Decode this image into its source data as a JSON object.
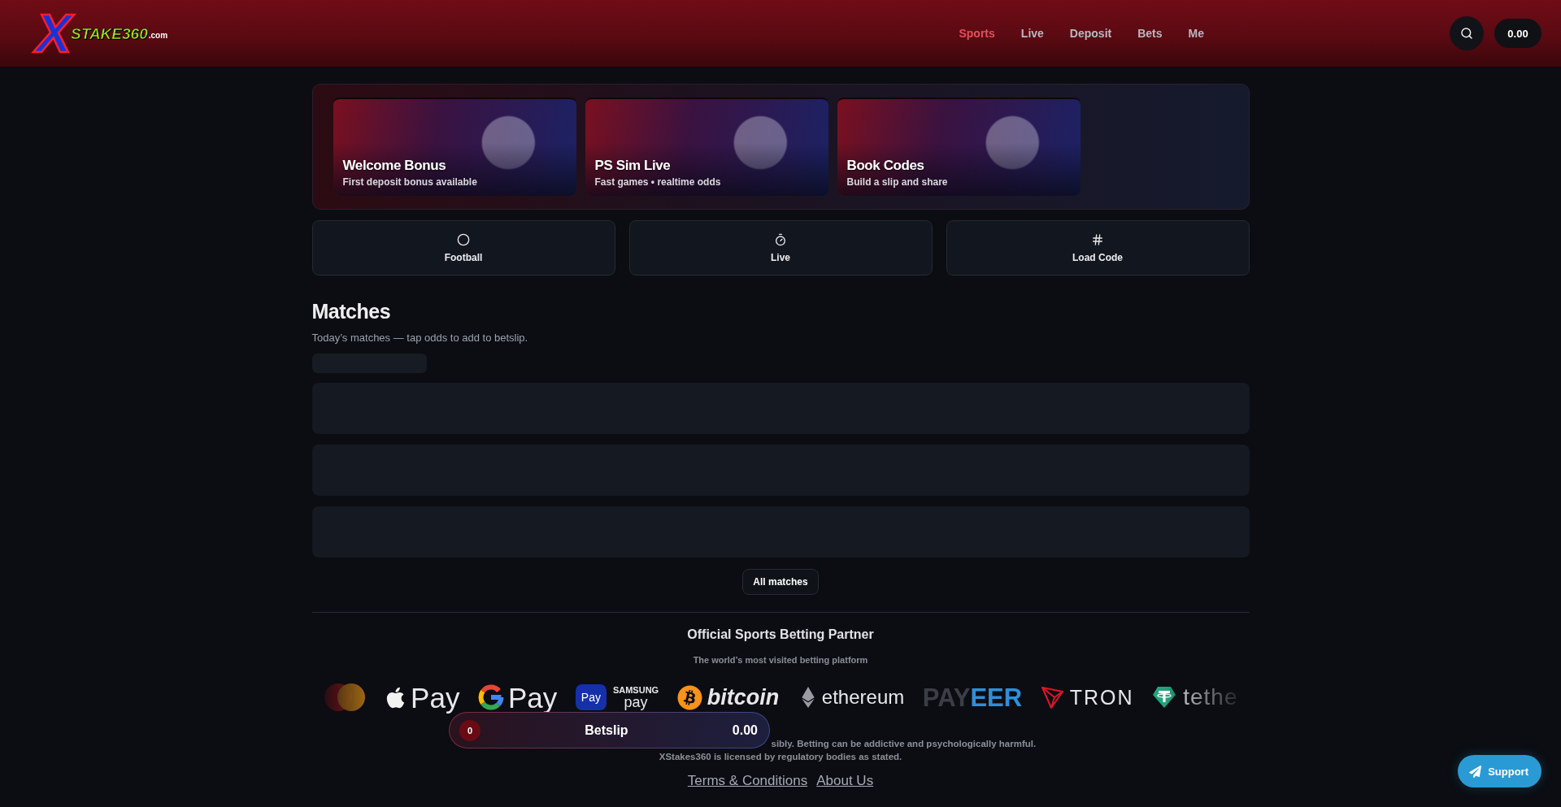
{
  "header": {
    "logo": {
      "mark": "X",
      "name": "STAKE360",
      "suffix": ".com"
    },
    "nav": [
      {
        "label": "Sports",
        "selected": true
      },
      {
        "label": "Live",
        "selected": false
      },
      {
        "label": "Deposit",
        "selected": false
      },
      {
        "label": "Bets",
        "selected": false
      },
      {
        "label": "Me",
        "selected": false
      }
    ],
    "balance": "0.00"
  },
  "promos": [
    {
      "title": "Welcome Bonus",
      "subtitle": "First deposit bonus available"
    },
    {
      "title": "PS Sim Live",
      "subtitle": "Fast games • realtime odds"
    },
    {
      "title": "Book Codes",
      "subtitle": "Build a slip and share"
    }
  ],
  "quick_links": [
    {
      "kind": "football",
      "label": "Football"
    },
    {
      "kind": "live",
      "label": "Live"
    },
    {
      "kind": "code",
      "label": "Load Code"
    }
  ],
  "matches": {
    "title": "Matches",
    "subtitle": "Today’s matches — tap odds to add to betslip.",
    "loading": true,
    "button": "All matches"
  },
  "partner": {
    "title": "Official Sports Betting Partner",
    "tagline": "The world’s most visited betting platform",
    "payments": [
      {
        "kind": "mastercard"
      },
      {
        "kind": "applepay",
        "text": "Pay"
      },
      {
        "kind": "gpay",
        "text": "Pay"
      },
      {
        "kind": "samsungpay",
        "badge": "Pay",
        "top": "SAMSUNG",
        "bottom": "pay"
      },
      {
        "kind": "bitcoin",
        "text": "bitcoin"
      },
      {
        "kind": "ethereum",
        "text": "ethereum"
      },
      {
        "kind": "payeer",
        "text": "PAY",
        "accent": "EER"
      },
      {
        "kind": "tron",
        "text": "TRON"
      },
      {
        "kind": "tether",
        "text": "tethe"
      }
    ]
  },
  "footer": {
    "notice": [
      "sibly. Betting can be addictive and psychologically harmful.",
      "XStakes360 is licensed by regulatory bodies as stated."
    ],
    "links": [
      "Terms & Conditions",
      "About Us"
    ]
  },
  "betslip": {
    "count": "0",
    "label": "Betslip",
    "total": "0.00"
  },
  "support": {
    "label": "Support"
  }
}
